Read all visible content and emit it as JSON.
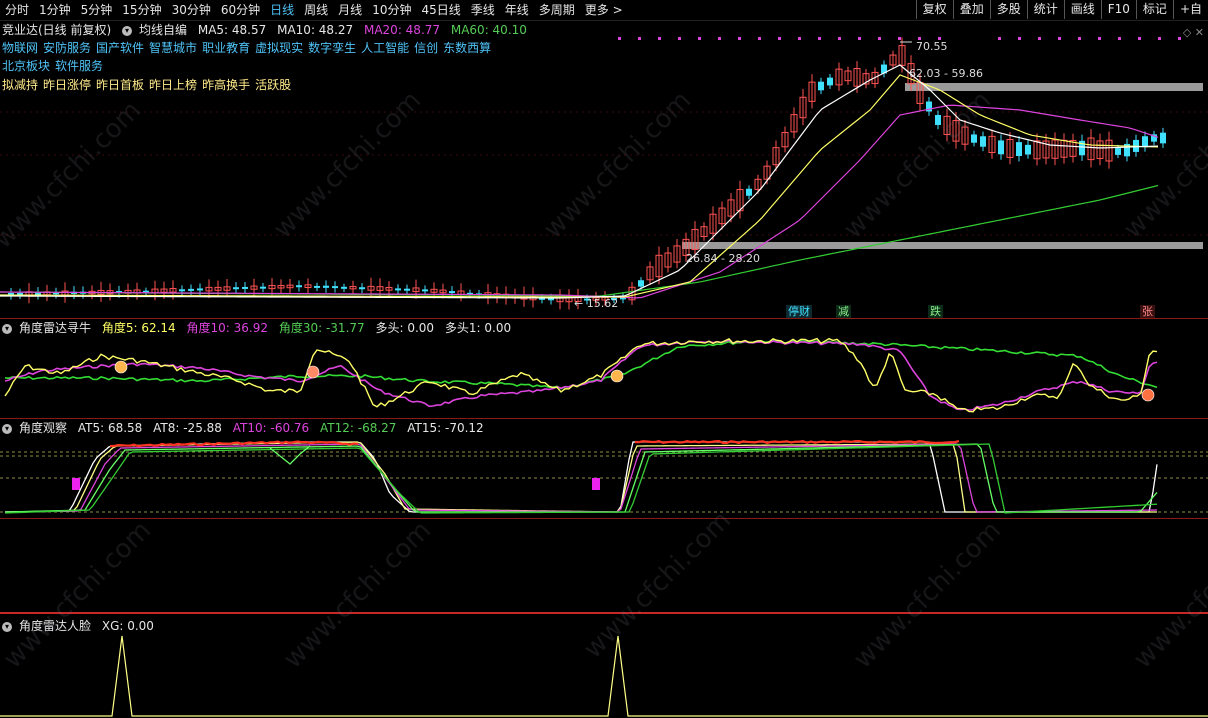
{
  "toolbar": {
    "periods": [
      "分时",
      "1分钟",
      "5分钟",
      "15分钟",
      "30分钟",
      "60分钟",
      "日线",
      "周线",
      "月线",
      "10分钟",
      "45日线",
      "季线",
      "年线",
      "多周期",
      "更多 >"
    ],
    "active_index": 6,
    "right_tools": [
      "复权",
      "叠加",
      "多股",
      "统计",
      "画线",
      "F10",
      "标记",
      "+自"
    ]
  },
  "main": {
    "stock_name": "竞业达(日线 前复权)",
    "indicator_name": "均线自编",
    "ma5": "MA5: 48.57",
    "ma10": "MA10: 48.27",
    "ma20": "MA20: 48.77",
    "ma60": "MA60: 40.10",
    "concept_line1": [
      "物联网",
      "安防服务",
      "国产软件",
      "智慧城市",
      "职业教育",
      "虚拟现实",
      "数字孪生",
      "人工智能",
      "信创",
      "东数西算"
    ],
    "concept_line2": [
      "北京板块",
      "软件服务"
    ],
    "concept_line3": [
      "拟减持",
      "昨日涨停",
      "昨日首板",
      "昨日上榜",
      "昨高换手",
      "活跃股"
    ],
    "high_label": "70.55",
    "band_upper_label": "62.03 - 59.86",
    "band_lower_label": "26.84 - 28.20",
    "low_label": "15.62",
    "event_labels": [
      "停财",
      "减",
      "跌",
      "张"
    ]
  },
  "panel1": {
    "name": "角度雷达寻牛",
    "v1": "角度5: 62.14",
    "v2": "角度10: 36.92",
    "v3": "角度30: -31.77",
    "v4": "多头: 0.00",
    "v5": "多头1: 0.00"
  },
  "panel2": {
    "name": "角度观察",
    "v1": "AT5: 68.58",
    "v2": "AT8: -25.88",
    "v3": "AT10: -60.76",
    "v4": "AT12: -68.27",
    "v5": "AT15: -70.12"
  },
  "panel3": {
    "name": "角度雷达人脸",
    "v1": "XG: 0.00"
  },
  "watermark": "www.cfchi.com",
  "colors": {
    "up": "#ff5252",
    "down": "#40e0ff",
    "ma5": "#ffffff",
    "ma10": "#ffff66",
    "ma20": "#dd44dd",
    "ma60": "#33cc33",
    "accent": "#4fc3f7"
  }
}
